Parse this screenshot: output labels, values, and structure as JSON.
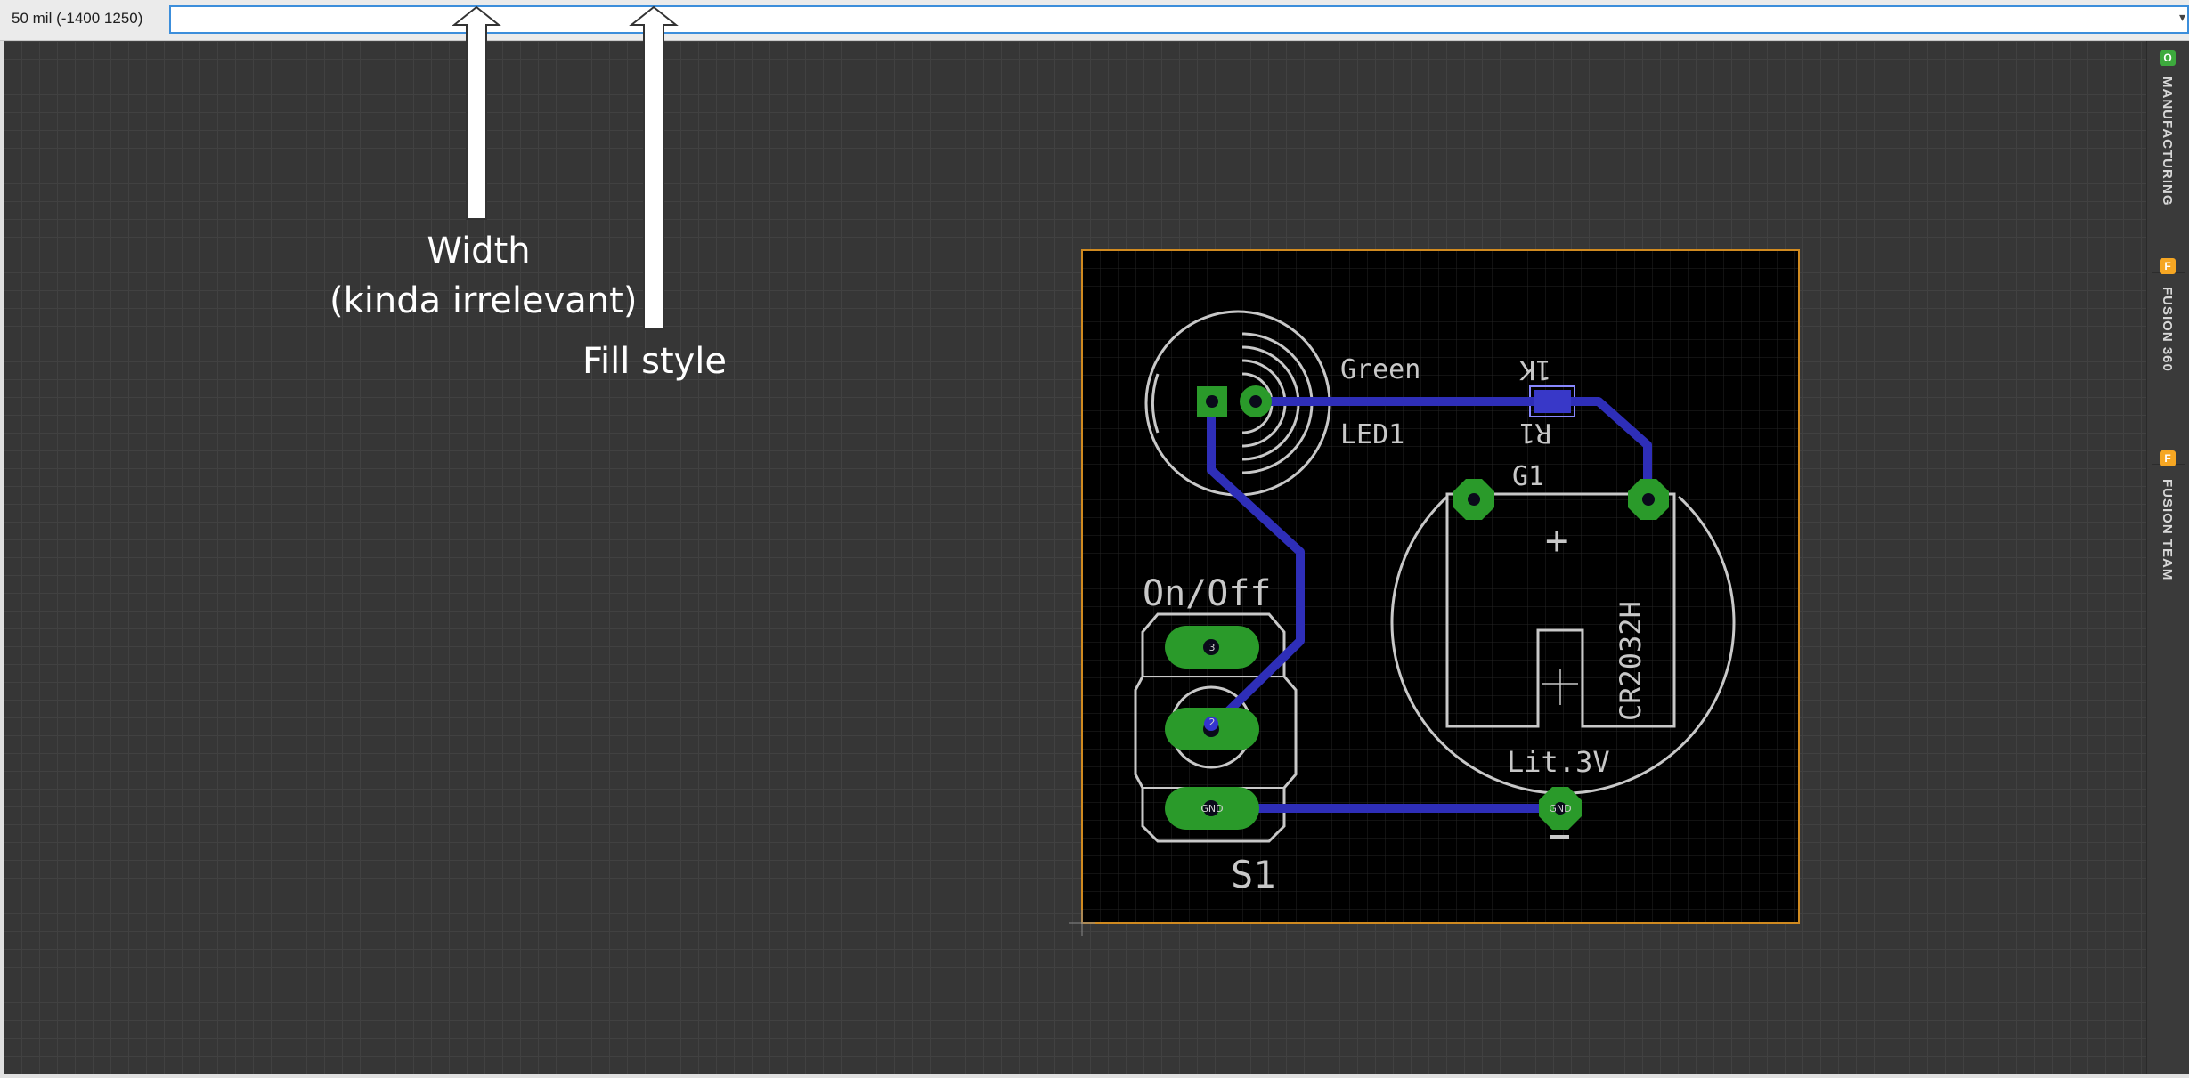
{
  "topbar": {
    "coordinate_readout": "50 mil (-1400 1250)",
    "command_input_value": ""
  },
  "side_panel": {
    "tabs": [
      {
        "label": "MANUFACTURING",
        "icon": "manufacturing-icon",
        "badge": "O",
        "color": "#3daa3d"
      },
      {
        "label": "FUSION 360",
        "icon": "fusion360-icon",
        "badge": "F",
        "color": "#f5a623"
      },
      {
        "label": "FUSION TEAM",
        "icon": "fusion-team-icon",
        "badge": "F",
        "color": "#f5a623"
      }
    ]
  },
  "annotations": {
    "width_line1": "Width",
    "width_line2": "(kinda irrelevant)",
    "fill_style": "Fill style"
  },
  "board": {
    "labels": {
      "green": "Green",
      "led1": "LED1",
      "r_value": "1K",
      "r_name": "R1",
      "g1": "G1",
      "onoff": "On/Off",
      "cr2032h": "CR2032H",
      "lit3v": "Lit.3V",
      "s1": "S1",
      "plus": "+",
      "minus": "−"
    },
    "pad_labels": {
      "gnd1": "GND",
      "gnd2": "GND",
      "pin2": "2",
      "pin3": "3"
    },
    "colors": {
      "board_bg": "#000000",
      "outline": "#d08a20",
      "silkscreen": "#c8c8c8",
      "trace": "#2e2eb8",
      "pad": "#2a9a2a"
    }
  }
}
